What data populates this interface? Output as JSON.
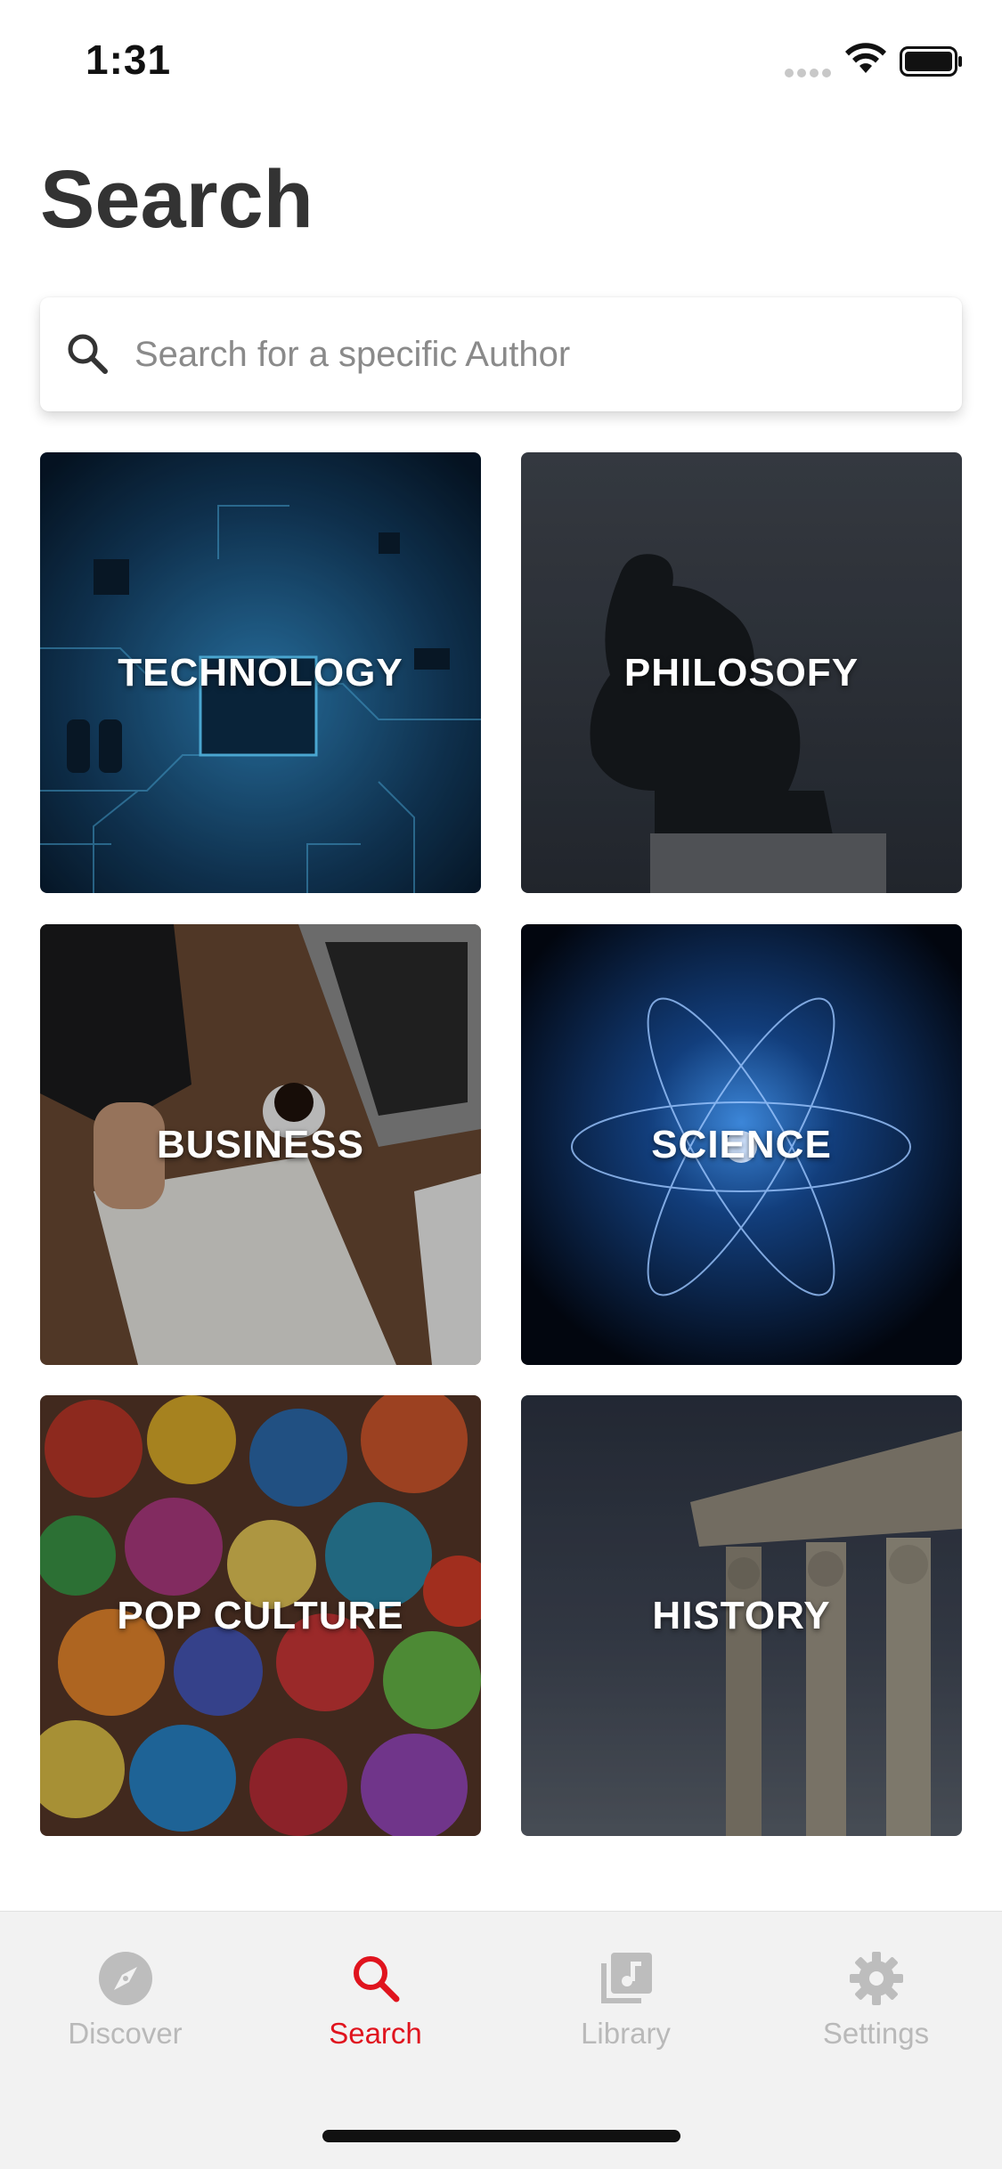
{
  "status_bar": {
    "time": "1:31"
  },
  "page": {
    "title": "Search"
  },
  "search": {
    "placeholder": "Search for a specific Author",
    "icon": "search-icon"
  },
  "categories": [
    {
      "label": "TECHNOLOGY"
    },
    {
      "label": "PHILOSOFY"
    },
    {
      "label": "BUSINESS"
    },
    {
      "label": "SCIENCE"
    },
    {
      "label": "POP CULTURE"
    },
    {
      "label": "HISTORY"
    }
  ],
  "tabs": [
    {
      "label": "Discover",
      "icon": "compass-icon"
    },
    {
      "label": "Search",
      "icon": "search-icon",
      "active": true
    },
    {
      "label": "Library",
      "icon": "library-icon"
    },
    {
      "label": "Settings",
      "icon": "gear-icon"
    }
  ],
  "colors": {
    "accent": "#e0141e",
    "inactive": "#b9b9b9",
    "title": "#333333"
  }
}
